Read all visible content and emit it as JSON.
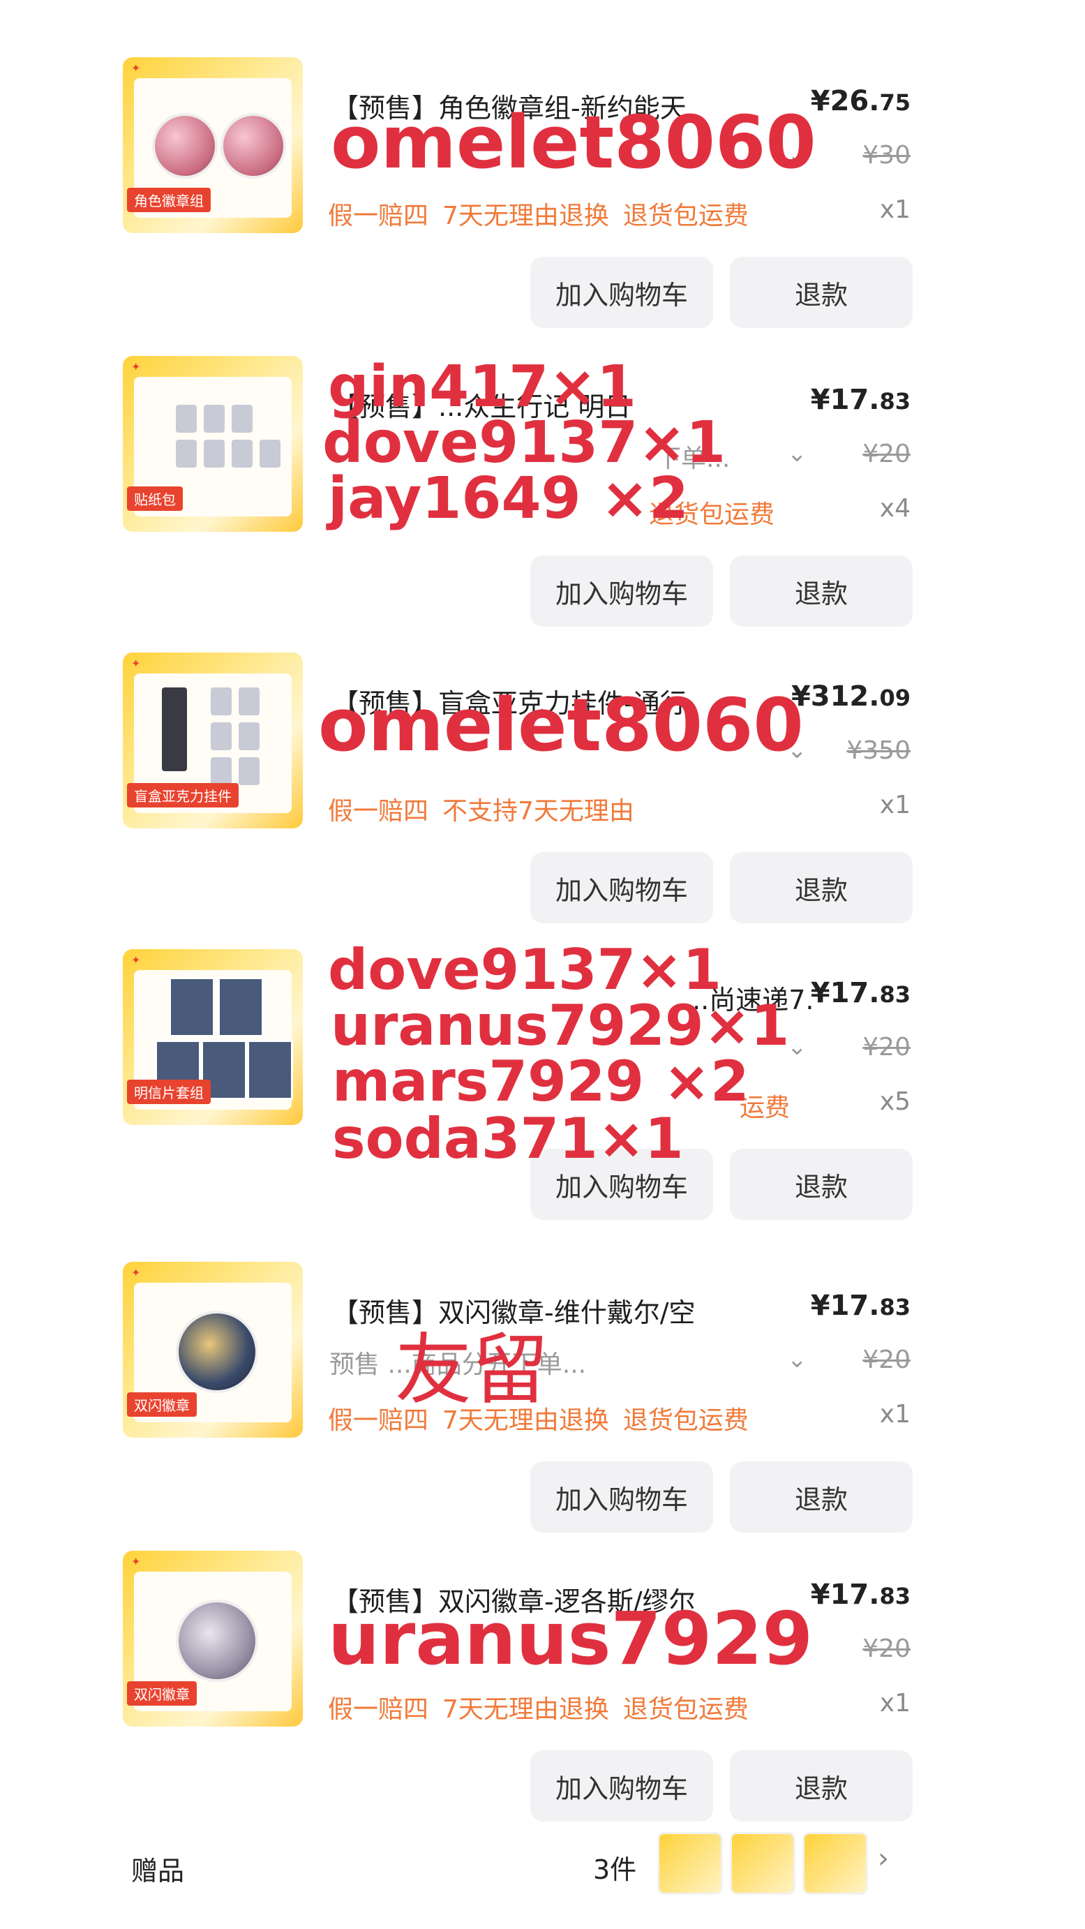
{
  "items": [
    {
      "title": "【预售】角色徽章组-新约能天",
      "price_main": "¥26.",
      "price_cents": "75",
      "sku": "",
      "original_price": "¥30",
      "services": [
        "假一赔四",
        "7天无理由退换",
        "退货包运费"
      ],
      "qty": "x1",
      "thumb_tag": "角色徽章组",
      "overlay": [
        "omelet8060"
      ]
    },
    {
      "title": "【预售】...众生行记 明日",
      "price_main": "¥17.",
      "price_cents": "83",
      "sku": "下单...",
      "original_price": "¥20",
      "services": [
        "退货包运费"
      ],
      "qty": "x4",
      "thumb_tag": "贴纸包",
      "overlay": [
        "gin417×1",
        "dove9137×1",
        "jay1649 ×2"
      ]
    },
    {
      "title": "【预售】盲盒亚克力挂件-通行",
      "price_main": "¥312.",
      "price_cents": "09",
      "sku": "",
      "original_price": "¥350",
      "services": [
        "假一赔四",
        "不支持7天无理由"
      ],
      "qty": "x1",
      "thumb_tag": "盲盒亚克力挂件",
      "overlay": [
        "omelet8060"
      ]
    },
    {
      "title": "...尚速递7.",
      "price_main": "¥17.",
      "price_cents": "83",
      "sku": "",
      "original_price": "¥20",
      "services": [
        "运费"
      ],
      "qty": "x5",
      "thumb_tag": "明信片套组",
      "overlay": [
        "dove9137×1",
        "uranus7929×1",
        "mars7929 ×2",
        "soda371×1"
      ]
    },
    {
      "title": "【预售】双闪徽章-维什戴尔/空",
      "price_main": "¥17.",
      "price_cents": "83",
      "sku": "预售 ...商品分开下单...",
      "original_price": "¥20",
      "services": [
        "假一赔四",
        "7天无理由退换",
        "退货包运费"
      ],
      "qty": "x1",
      "thumb_tag": "双闪徽章",
      "overlay": [
        "友留"
      ]
    },
    {
      "title": "【预售】双闪徽章-逻各斯/缪尔",
      "price_main": "¥17.",
      "price_cents": "83",
      "sku": "",
      "original_price": "¥20",
      "services": [
        "假一赔四",
        "7天无理由退换",
        "退货包运费"
      ],
      "qty": "x1",
      "thumb_tag": "双闪徽章",
      "overlay": [
        "uranus7929"
      ]
    }
  ],
  "buttons": {
    "add_to_cart": "加入购物车",
    "refund": "退款"
  },
  "gift": {
    "label": "赠品",
    "count": "3件",
    "chevron": "›"
  },
  "colors": {
    "overlay": "#e0303f",
    "service": "#f07a3a",
    "button_bg": "#f2f2f4"
  }
}
